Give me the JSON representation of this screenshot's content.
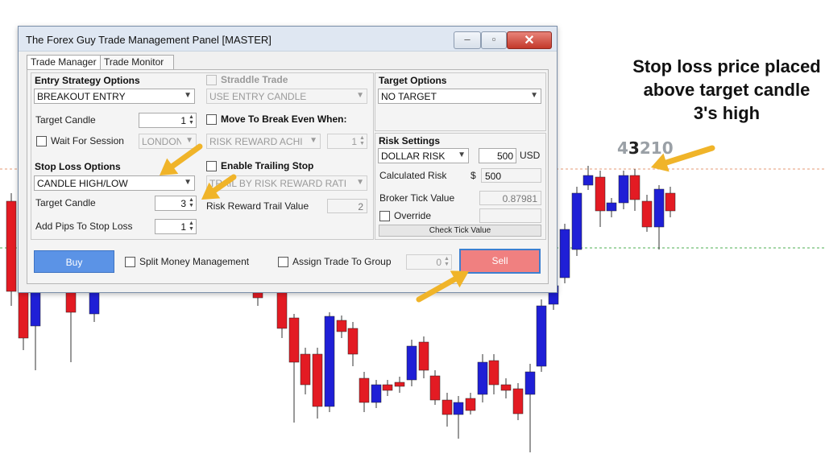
{
  "annotation": {
    "lines": [
      "Stop loss price placed",
      "above target candle",
      "3's high"
    ],
    "candle_numbers": [
      "4",
      "3",
      "2",
      "1",
      "0"
    ],
    "highlight_index": 1
  },
  "chart_bg": {
    "up_color": "#1f1fd6",
    "down_color": "#e31b23",
    "ref_line_upper_color": "#e69a74",
    "ref_line_lower_color": "#4caf50",
    "arrow_color": "#f0b429"
  },
  "window": {
    "title": "The Forex Guy Trade Management Panel [MASTER]",
    "min_glyph": "–",
    "max_glyph": "▫",
    "close_glyph": "✕"
  },
  "tabs": [
    "Trade Manager",
    "Trade Monitor"
  ],
  "entry": {
    "title": "Entry Strategy Options",
    "strategy": "BREAKOUT ENTRY",
    "target_candle_label": "Target Candle",
    "target_candle_value": "1",
    "wait_label": "Wait For Session",
    "session": "LONDON"
  },
  "straddle": {
    "label": "Straddle Trade",
    "mode": "USE ENTRY CANDLE"
  },
  "breakeven": {
    "label": "Move To Break Even When:",
    "mode": "RISK REWARD ACHI",
    "value": "1"
  },
  "target": {
    "title": "Target Options",
    "mode": "NO TARGET"
  },
  "stoploss": {
    "title": "Stop Loss Options",
    "mode": "CANDLE HIGH/LOW",
    "target_candle_label": "Target Candle",
    "target_candle_value": "3",
    "add_pips_label": "Add Pips To Stop Loss",
    "add_pips_value": "1"
  },
  "trailing": {
    "label": "Enable Trailing Stop",
    "mode": "TRAIL BY RISK REWARD RATI",
    "trail_label": "Risk Reward Trail Value",
    "trail_value": "2"
  },
  "risk": {
    "title": "Risk Settings",
    "mode": "DOLLAR RISK",
    "amount": "500",
    "currency": "USD",
    "calc_label": "Calculated Risk",
    "calc_symbol": "$",
    "calc_value": "500",
    "tick_label": "Broker Tick Value",
    "tick_value": "0.87981",
    "override_label": "Override",
    "check_button": "Check Tick Value"
  },
  "bottom": {
    "buy": "Buy",
    "split_label": "Split Money Management",
    "assign_label": "Assign Trade To Group",
    "group_value": "0",
    "sell": "Sell"
  }
}
